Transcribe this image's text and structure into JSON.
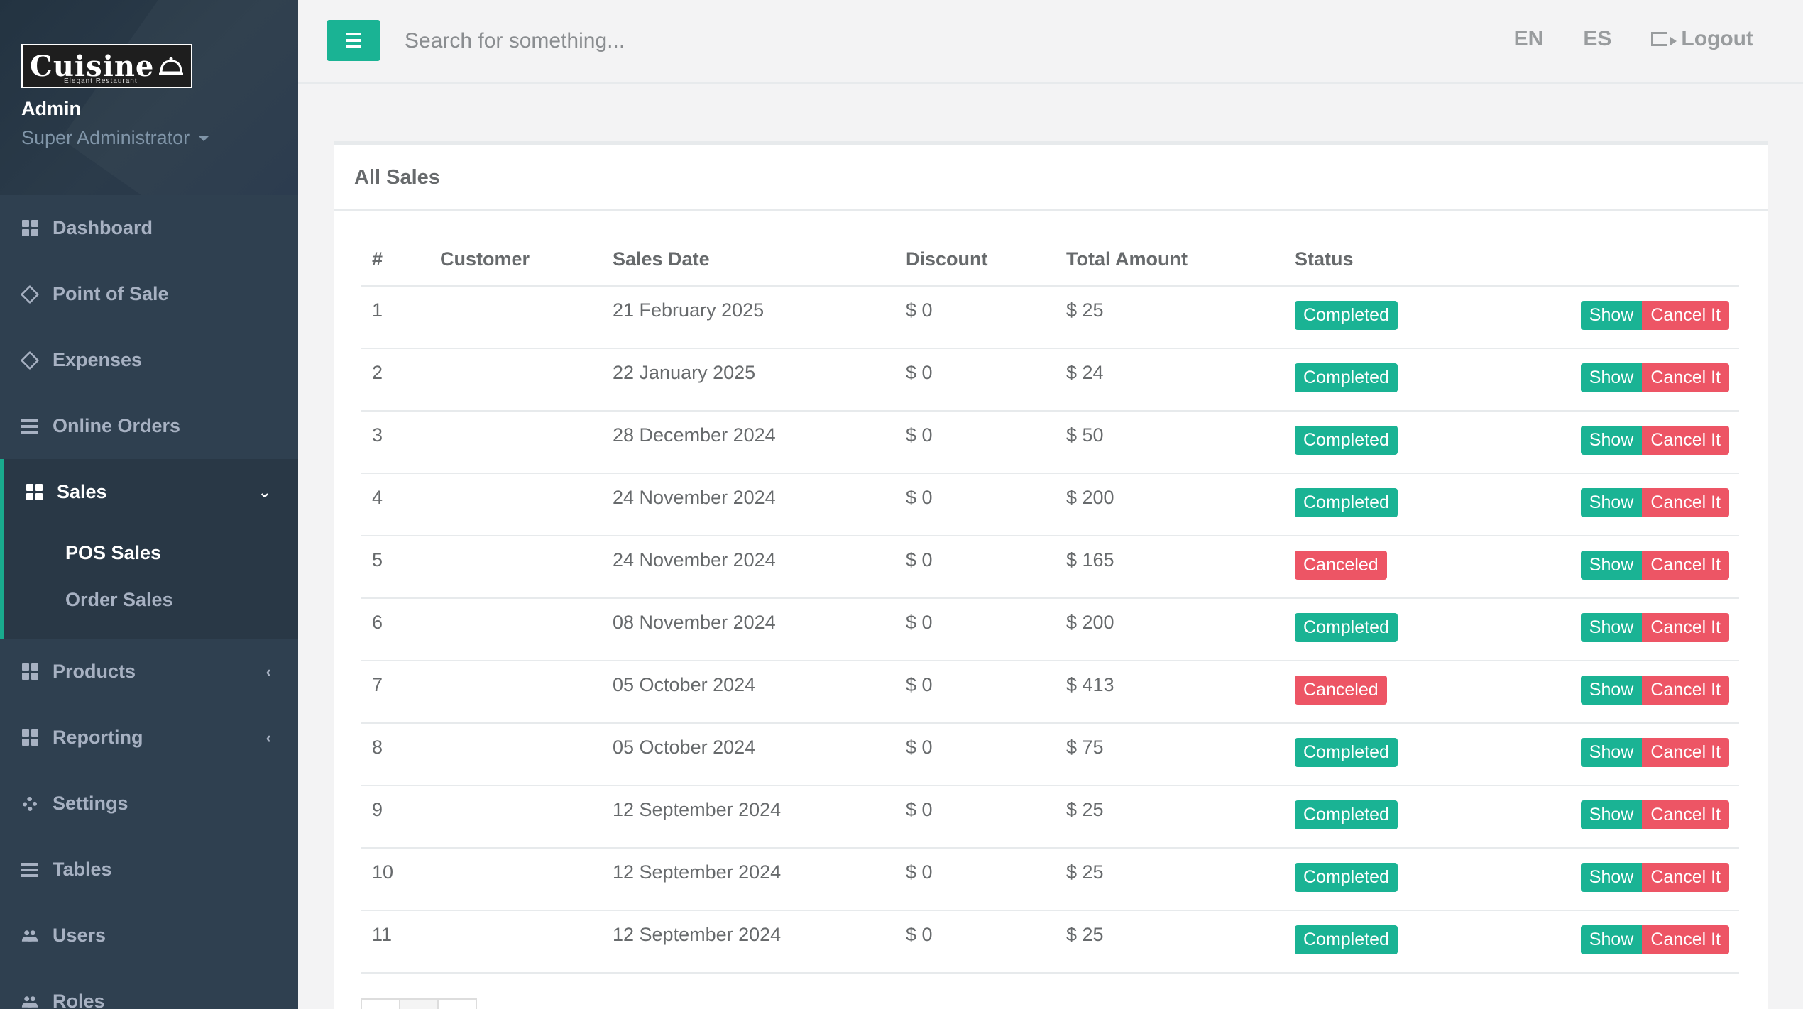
{
  "brand": {
    "logo_text": "Cuisine",
    "logo_tagline": "Elegant Restaurant"
  },
  "profile": {
    "name": "Admin",
    "role": "Super Administrator"
  },
  "sidebar": {
    "items": [
      {
        "label": "Dashboard",
        "icon": "dashboard-icon"
      },
      {
        "label": "Point of Sale",
        "icon": "diamond-icon"
      },
      {
        "label": "Expenses",
        "icon": "diamond-icon"
      },
      {
        "label": "Online Orders",
        "icon": "list-icon"
      },
      {
        "label": "Sales",
        "icon": "grid-icon",
        "expanded": true
      },
      {
        "label": "Products",
        "icon": "grid-icon"
      },
      {
        "label": "Reporting",
        "icon": "grid-icon"
      },
      {
        "label": "Settings",
        "icon": "gear-icon"
      },
      {
        "label": "Tables",
        "icon": "list-icon"
      },
      {
        "label": "Users",
        "icon": "users-icon"
      },
      {
        "label": "Roles",
        "icon": "users-icon"
      }
    ],
    "sales_sub": [
      "POS Sales",
      "Order Sales"
    ]
  },
  "topbar": {
    "search_placeholder": "Search for something...",
    "lang_en": "EN",
    "lang_es": "ES",
    "logout": "Logout"
  },
  "panel": {
    "title": "All Sales"
  },
  "table": {
    "headers": [
      "#",
      "Customer",
      "Sales Date",
      "Discount",
      "Total Amount",
      "Status"
    ],
    "show_label": "Show",
    "cancel_label": "Cancel It",
    "status_colors": {
      "Completed": "#1ab394",
      "Canceled": "#ed5565"
    },
    "rows": [
      {
        "id": "1",
        "customer": "",
        "date": "21 February 2025",
        "discount": "$ 0",
        "total": "$ 25",
        "status": "Completed"
      },
      {
        "id": "2",
        "customer": "",
        "date": "22 January 2025",
        "discount": "$ 0",
        "total": "$ 24",
        "status": "Completed"
      },
      {
        "id": "3",
        "customer": "",
        "date": "28 December 2024",
        "discount": "$ 0",
        "total": "$ 50",
        "status": "Completed"
      },
      {
        "id": "4",
        "customer": "",
        "date": "24 November 2024",
        "discount": "$ 0",
        "total": "$ 200",
        "status": "Completed"
      },
      {
        "id": "5",
        "customer": "",
        "date": "24 November 2024",
        "discount": "$ 0",
        "total": "$ 165",
        "status": "Canceled"
      },
      {
        "id": "6",
        "customer": "",
        "date": "08 November 2024",
        "discount": "$ 0",
        "total": "$ 200",
        "status": "Completed"
      },
      {
        "id": "7",
        "customer": "",
        "date": "05 October 2024",
        "discount": "$ 0",
        "total": "$ 413",
        "status": "Canceled"
      },
      {
        "id": "8",
        "customer": "",
        "date": "05 October 2024",
        "discount": "$ 0",
        "total": "$ 75",
        "status": "Completed"
      },
      {
        "id": "9",
        "customer": "",
        "date": "12 September 2024",
        "discount": "$ 0",
        "total": "$ 25",
        "status": "Completed"
      },
      {
        "id": "10",
        "customer": "",
        "date": "12 September 2024",
        "discount": "$ 0",
        "total": "$ 25",
        "status": "Completed"
      },
      {
        "id": "11",
        "customer": "",
        "date": "12 September 2024",
        "discount": "$ 0",
        "total": "$ 25",
        "status": "Completed"
      }
    ]
  }
}
